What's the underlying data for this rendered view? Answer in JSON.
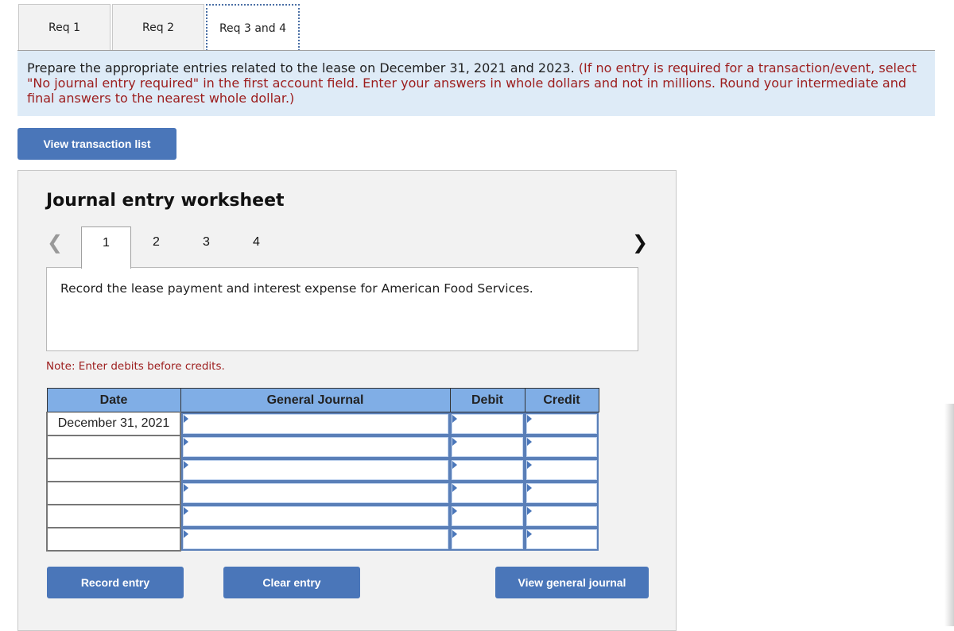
{
  "req_tabs": [
    {
      "label": "Req 1",
      "active": false
    },
    {
      "label": "Req 2",
      "active": false
    },
    {
      "label": "Req 3 and 4",
      "active": true
    }
  ],
  "instructions": {
    "main": "Prepare the appropriate entries related to the lease on December 31, 2021 and 2023. ",
    "note": "(If no entry is required for a transaction/event, select \"No journal entry required\" in the first account field. Enter your answers in whole dollars and not in millions. Round your intermediate and final answers to the nearest whole dollar.)"
  },
  "buttons": {
    "view_transaction_list": "View transaction list",
    "record_entry": "Record entry",
    "clear_entry": "Clear entry",
    "view_general_journal": "View general journal"
  },
  "worksheet": {
    "title": "Journal entry worksheet",
    "prev_icon": "<",
    "next_icon": ">",
    "steps": [
      "1",
      "2",
      "3",
      "4"
    ],
    "active_step": "1",
    "description": "Record the lease payment and interest expense for American Food Services.",
    "note": "Note: Enter debits before credits."
  },
  "journal_table": {
    "headers": {
      "date": "Date",
      "account": "General Journal",
      "debit": "Debit",
      "credit": "Credit"
    },
    "rows": [
      {
        "date": "December 31, 2021",
        "account": "",
        "debit": "",
        "credit": ""
      },
      {
        "date": "",
        "account": "",
        "debit": "",
        "credit": ""
      },
      {
        "date": "",
        "account": "",
        "debit": "",
        "credit": ""
      },
      {
        "date": "",
        "account": "",
        "debit": "",
        "credit": ""
      },
      {
        "date": "",
        "account": "",
        "debit": "",
        "credit": ""
      },
      {
        "date": "",
        "account": "",
        "debit": "",
        "credit": ""
      }
    ]
  },
  "colors": {
    "button_blue": "#4a76b9",
    "header_blue": "#80aee6",
    "instruction_bg": "#deebf7",
    "note_red": "#9c1c1c"
  }
}
